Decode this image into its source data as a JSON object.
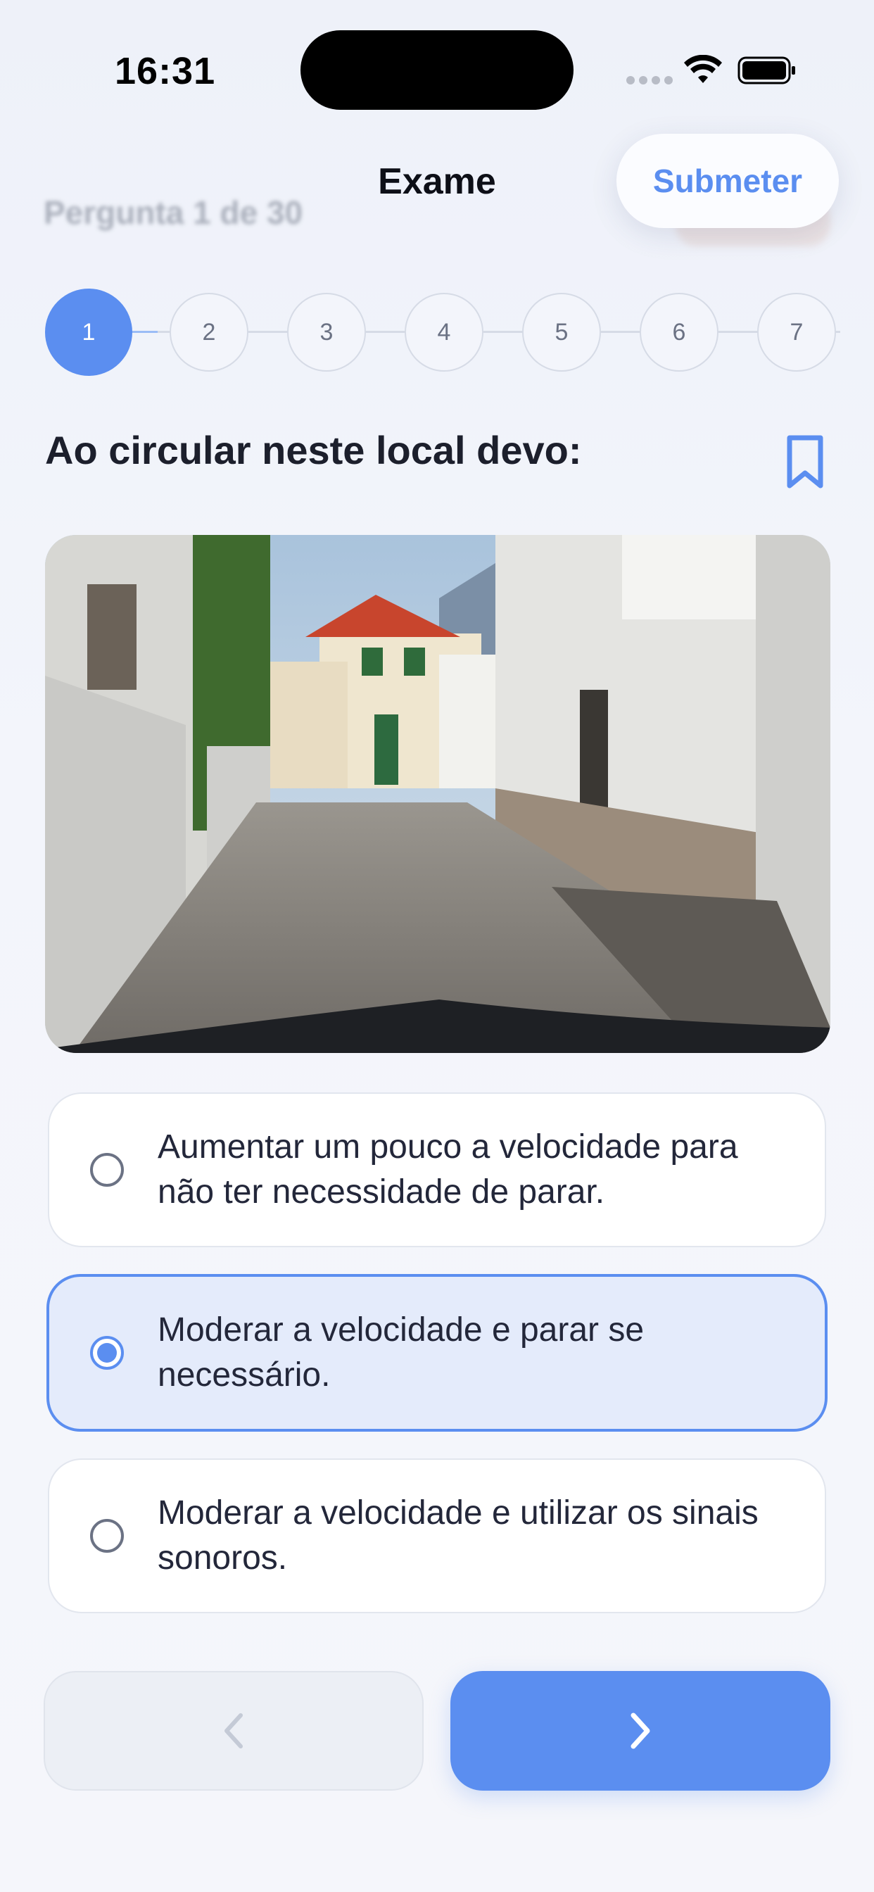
{
  "status_bar": {
    "time": "16:31"
  },
  "background_header": {
    "progress_text": "Pergunta 1 de 30"
  },
  "nav": {
    "title": "Exame",
    "submit_label": "Submeter"
  },
  "stepper": {
    "current": 1,
    "steps": [
      "1",
      "2",
      "3",
      "4",
      "5",
      "6",
      "7"
    ]
  },
  "question": {
    "text": "Ao circular neste local devo:",
    "image_description": "narrow-village-street-photo"
  },
  "options": [
    {
      "text": "Aumentar um pouco a velocidade para não ter necessidade de parar.",
      "selected": false
    },
    {
      "text": "Moderar a velocidade e parar se necessário.",
      "selected": true
    },
    {
      "text": "Moderar a velocidade e utilizar os sinais sonoros.",
      "selected": false
    }
  ],
  "colors": {
    "accent": "#5b8ef0",
    "selected_bg": "#e4ebfb",
    "text": "#1c1f2c",
    "muted": "#6b7284"
  },
  "icons": {
    "bookmark": "bookmark-icon",
    "prev": "chevron-left-icon",
    "next": "chevron-right-icon",
    "wifi": "wifi-icon",
    "battery": "battery-icon"
  }
}
